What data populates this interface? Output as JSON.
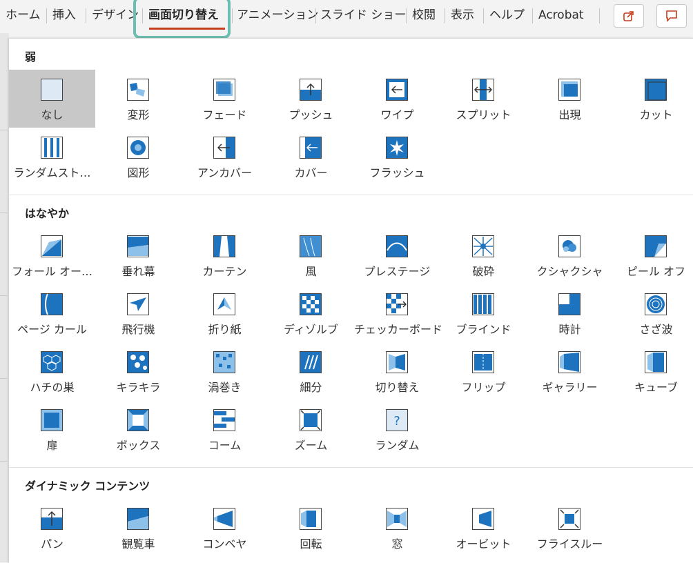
{
  "ribbon": {
    "tabs": [
      "ホーム",
      "挿入",
      "デザイン",
      "画面切り替え",
      "アニメーション",
      "スライド ショー",
      "校閲",
      "表示",
      "ヘルプ",
      "Acrobat"
    ],
    "active_tab": "画面切り替え",
    "share_icon": "share-icon",
    "comment_icon": "comment-icon"
  },
  "sections": [
    {
      "title": "弱",
      "items": [
        {
          "label": "なし",
          "icon": "none"
        },
        {
          "label": "変形",
          "icon": "morph"
        },
        {
          "label": "フェード",
          "icon": "fade"
        },
        {
          "label": "プッシュ",
          "icon": "push"
        },
        {
          "label": "ワイプ",
          "icon": "wipe"
        },
        {
          "label": "スプリット",
          "icon": "split"
        },
        {
          "label": "出現",
          "icon": "reveal"
        },
        {
          "label": "カット",
          "icon": "cut"
        },
        {
          "label": "ランダムスト…",
          "icon": "bars"
        },
        {
          "label": "図形",
          "icon": "shape"
        },
        {
          "label": "アンカバー",
          "icon": "uncover"
        },
        {
          "label": "カバー",
          "icon": "cover"
        },
        {
          "label": "フラッシュ",
          "icon": "flash"
        }
      ]
    },
    {
      "title": "はなやか",
      "items": [
        {
          "label": "フォール オー…",
          "icon": "fall"
        },
        {
          "label": "垂れ幕",
          "icon": "drape"
        },
        {
          "label": "カーテン",
          "icon": "curtain"
        },
        {
          "label": "風",
          "icon": "wind"
        },
        {
          "label": "プレステージ",
          "icon": "prestige"
        },
        {
          "label": "破砕",
          "icon": "fracture"
        },
        {
          "label": "クシャクシャ",
          "icon": "crush"
        },
        {
          "label": "ピール オフ",
          "icon": "peel"
        },
        {
          "label": "ページ カール",
          "icon": "pagecurl"
        },
        {
          "label": "飛行機",
          "icon": "airplane"
        },
        {
          "label": "折り紙",
          "icon": "origami"
        },
        {
          "label": "ディゾルブ",
          "icon": "dissolve"
        },
        {
          "label": "チェッカーボード",
          "icon": "checker"
        },
        {
          "label": "ブラインド",
          "icon": "blinds"
        },
        {
          "label": "時計",
          "icon": "clock"
        },
        {
          "label": "さざ波",
          "icon": "ripple"
        },
        {
          "label": "ハチの巣",
          "icon": "honeycomb"
        },
        {
          "label": "キラキラ",
          "icon": "glitter"
        },
        {
          "label": "渦巻き",
          "icon": "vortex"
        },
        {
          "label": "細分",
          "icon": "shred"
        },
        {
          "label": "切り替え",
          "icon": "switch"
        },
        {
          "label": "フリップ",
          "icon": "flip"
        },
        {
          "label": "ギャラリー",
          "icon": "gallery"
        },
        {
          "label": "キューブ",
          "icon": "cube"
        },
        {
          "label": "扉",
          "icon": "doors"
        },
        {
          "label": "ボックス",
          "icon": "box"
        },
        {
          "label": "コーム",
          "icon": "comb"
        },
        {
          "label": "ズーム",
          "icon": "zoom"
        },
        {
          "label": "ランダム",
          "icon": "random"
        }
      ]
    },
    {
      "title": "ダイナミック コンテンツ",
      "items": [
        {
          "label": "パン",
          "icon": "pan"
        },
        {
          "label": "観覧車",
          "icon": "ferris"
        },
        {
          "label": "コンベヤ",
          "icon": "conveyor"
        },
        {
          "label": "回転",
          "icon": "rotate"
        },
        {
          "label": "窓",
          "icon": "window"
        },
        {
          "label": "オービット",
          "icon": "orbit"
        },
        {
          "label": "フライスルー",
          "icon": "flythrough"
        }
      ]
    }
  ],
  "selected": "なし",
  "colors": {
    "accent": "#1e73be",
    "highlight": "#6cbfb0",
    "active_underline": "#c43e1c",
    "selected_bg": "#c8c8c8"
  }
}
